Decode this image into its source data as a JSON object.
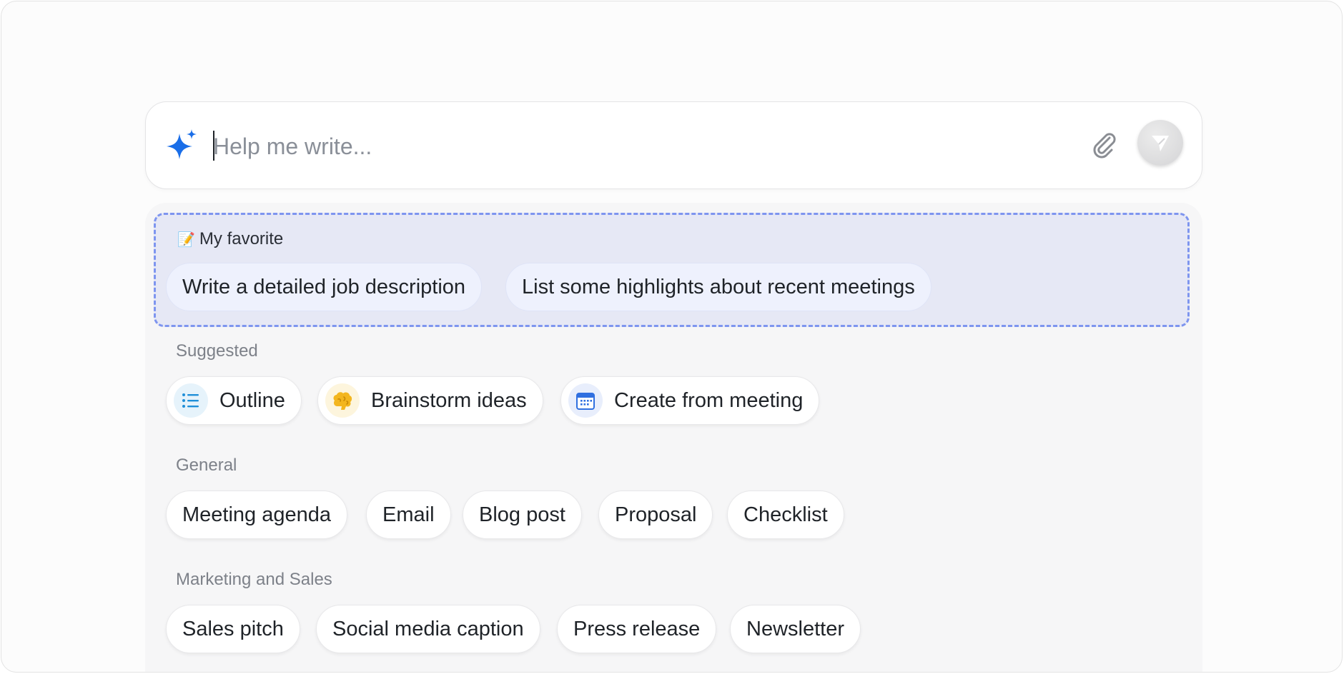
{
  "prompt": {
    "placeholder": "Help me write...",
    "sparkle_icon": "sparkle-icon",
    "attach_icon": "paperclip-icon",
    "send_icon": "send-icon",
    "accent_color": "#1a6ee8"
  },
  "favorites": {
    "title": "My favorite",
    "title_icon": "memo-icon",
    "items": [
      "Write a detailed job description",
      "List some highlights about recent meetings"
    ]
  },
  "suggested": {
    "label": "Suggested",
    "items": [
      {
        "label": "Outline",
        "icon": "list-icon"
      },
      {
        "label": "Brainstorm ideas",
        "icon": "brain-icon"
      },
      {
        "label": "Create from meeting",
        "icon": "calendar-icon"
      }
    ]
  },
  "general": {
    "label": "General",
    "items": [
      "Meeting agenda",
      "Email",
      "Blog post",
      "Proposal",
      "Checklist"
    ]
  },
  "marketing": {
    "label": "Marketing and Sales",
    "items": [
      "Sales pitch",
      "Social media caption",
      "Press release",
      "Newsletter"
    ]
  }
}
